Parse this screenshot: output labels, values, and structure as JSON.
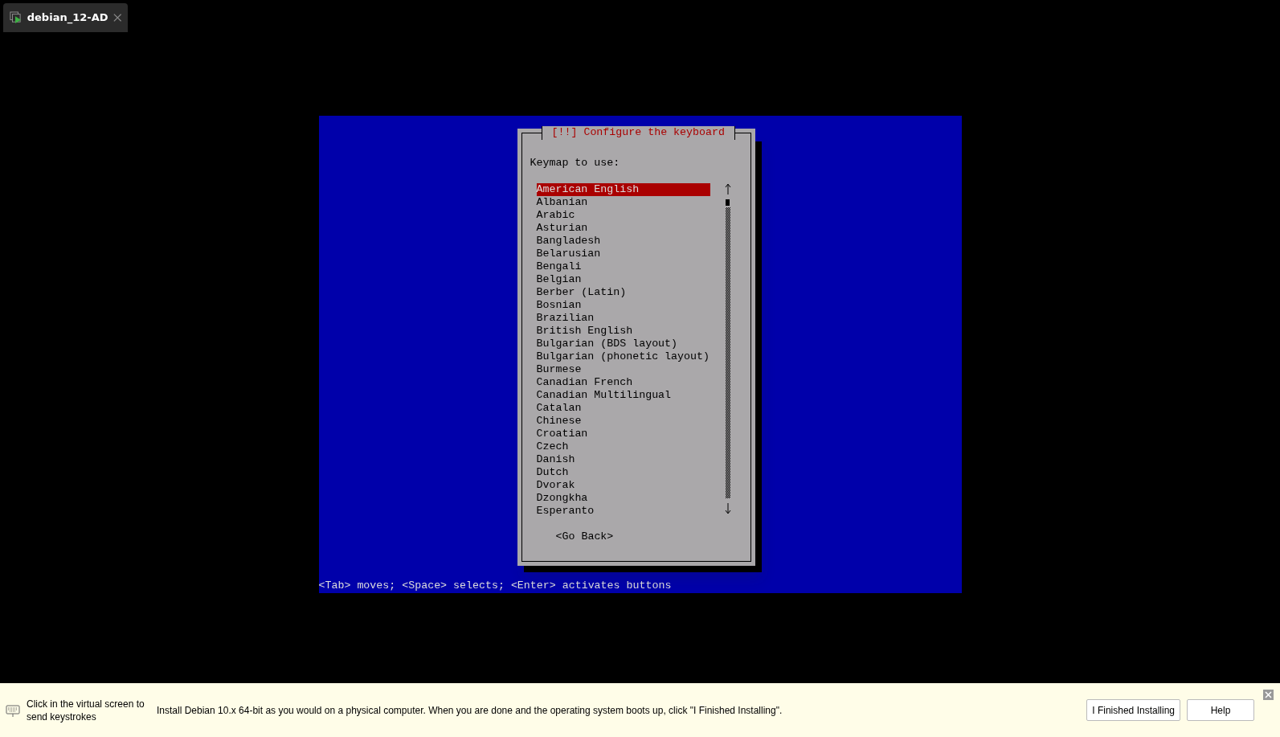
{
  "tab": {
    "title": "debian_12-AD"
  },
  "dialog": {
    "title": "[!!] Configure the keyboard",
    "prompt": "Keymap to use:",
    "items": [
      {
        "label": "American English",
        "selected": true
      },
      {
        "label": "Albanian",
        "selected": false
      },
      {
        "label": "Arabic",
        "selected": false
      },
      {
        "label": "Asturian",
        "selected": false
      },
      {
        "label": "Bangladesh",
        "selected": false
      },
      {
        "label": "Belarusian",
        "selected": false
      },
      {
        "label": "Bengali",
        "selected": false
      },
      {
        "label": "Belgian",
        "selected": false
      },
      {
        "label": "Berber (Latin)",
        "selected": false
      },
      {
        "label": "Bosnian",
        "selected": false
      },
      {
        "label": "Brazilian",
        "selected": false
      },
      {
        "label": "British English",
        "selected": false
      },
      {
        "label": "Bulgarian (BDS layout)",
        "selected": false
      },
      {
        "label": "Bulgarian (phonetic layout)",
        "selected": false
      },
      {
        "label": "Burmese",
        "selected": false
      },
      {
        "label": "Canadian French",
        "selected": false
      },
      {
        "label": "Canadian Multilingual",
        "selected": false
      },
      {
        "label": "Catalan",
        "selected": false
      },
      {
        "label": "Chinese",
        "selected": false
      },
      {
        "label": "Croatian",
        "selected": false
      },
      {
        "label": "Czech",
        "selected": false
      },
      {
        "label": "Danish",
        "selected": false
      },
      {
        "label": "Dutch",
        "selected": false
      },
      {
        "label": "Dvorak",
        "selected": false
      },
      {
        "label": "Dzongkha",
        "selected": false
      },
      {
        "label": "Esperanto",
        "selected": false
      }
    ],
    "button": "<Go Back>"
  },
  "help_line": "<Tab> moves; <Space> selects; <Enter> activates buttons",
  "bottom_bar": {
    "hint": "Click in the virtual screen to send keystrokes",
    "instruction": "Install Debian 10.x 64-bit as you would on a physical computer. When you are done and the operating system boots up, click \"I Finished Installing\".",
    "buttons": [
      "I Finished Installing",
      "Help"
    ]
  }
}
